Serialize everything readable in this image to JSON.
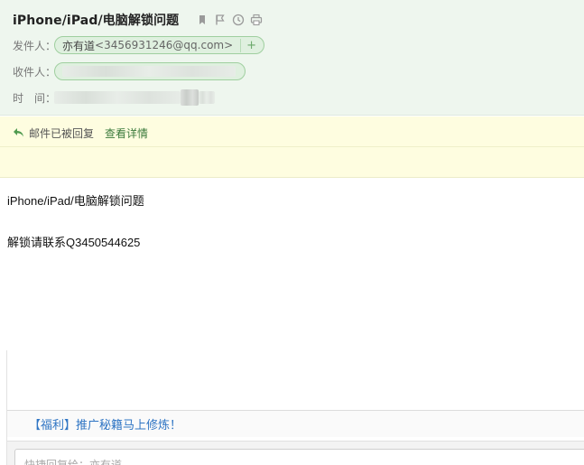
{
  "email": {
    "subject": "iPhone/iPad/电脑解锁问题",
    "actions": [
      {
        "name": "bookmark-icon"
      },
      {
        "name": "flag-icon"
      },
      {
        "name": "clock-icon"
      },
      {
        "name": "print-icon"
      }
    ],
    "sender_label": "发件人：",
    "sender_name": "亦有道",
    "sender_address": "<3456931246@qq.com>",
    "add_contact": "+",
    "recipient_label": "收件人：",
    "time_label": "时　间："
  },
  "notice": {
    "replied_text": "邮件已被回复",
    "details_link": "查看详情"
  },
  "content": {
    "line1": "iPhone/iPad/电脑解锁问题",
    "line2": "解锁请联系Q3450544625"
  },
  "promo": {
    "link": "【福利】推广秘籍马上修炼！"
  },
  "reply": {
    "placeholder": "快捷回复给：亦有道"
  },
  "colors": {
    "header_bg": "#eef6ee",
    "notice_bg": "#fefde0",
    "link_green": "#3b7a3b",
    "link_blue": "#2f75c4"
  }
}
